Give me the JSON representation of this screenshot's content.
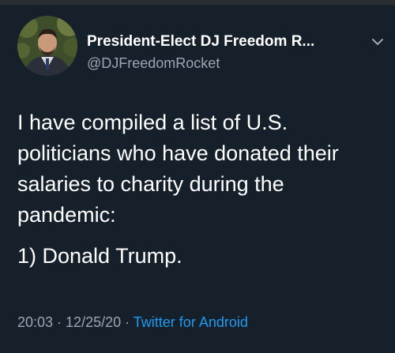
{
  "tweet": {
    "display_name": "President-Elect DJ Freedom R...",
    "handle": "@DJFreedomRocket",
    "text_paragraph": "I have compiled a list of U.S. politicians who have donated their salaries to charity during the pandemic:",
    "text_list_item": "1) Donald Trump.",
    "time": "20:03",
    "separator": " · ",
    "date": "12/25/20",
    "source": "Twitter for Android"
  },
  "icons": {
    "menu": "chevron-down-icon",
    "avatar": "avatar"
  },
  "colors": {
    "background": "#15202b",
    "secondary_text": "#9aa7b2",
    "link": "#1d9bf0"
  }
}
